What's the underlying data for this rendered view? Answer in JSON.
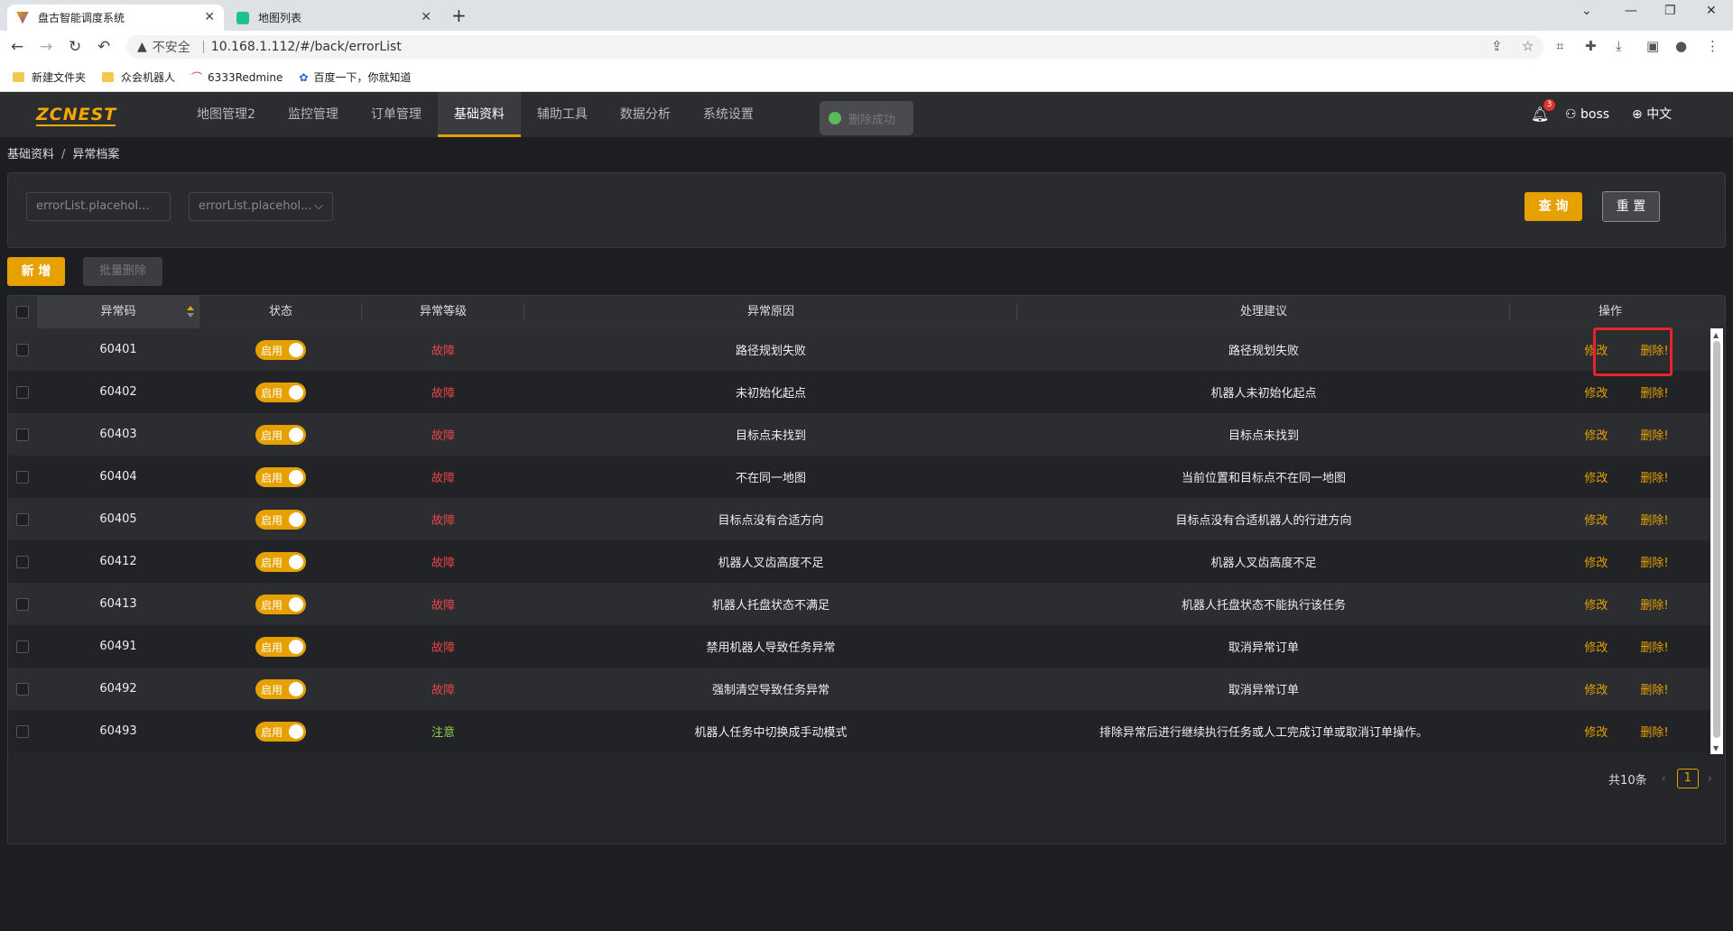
{
  "browser": {
    "tabs": [
      {
        "title": "盘古智能调度系统",
        "active": true
      },
      {
        "title": "地图列表",
        "active": false
      }
    ],
    "address": {
      "security": "不安全",
      "url": "10.168.1.112/#/back/errorList"
    },
    "bookmarks": [
      "新建文件夹",
      "众会机器人",
      "6333Redmine",
      "百度一下，你就知道"
    ]
  },
  "app": {
    "logo": "ZCNEST",
    "menu": [
      "地图管理2",
      "监控管理",
      "订单管理",
      "基础资料",
      "辅助工具",
      "数据分析",
      "系统设置"
    ],
    "active_menu": "基础资料",
    "toast": "删除成功",
    "notification_count": "3",
    "user": "boss",
    "language": "中文"
  },
  "breadcrumb": {
    "parent": "基础资料",
    "current": "异常档案"
  },
  "search": {
    "code_placeholder": "errorList.placehol...",
    "level_placeholder": "errorList.placehol...",
    "query_label": "查 询",
    "reset_label": "重 置"
  },
  "toolbar": {
    "add_label": "新 增",
    "batch_delete_label": "批量删除"
  },
  "table": {
    "columns": [
      "异常码",
      "状态",
      "异常等级",
      "异常原因",
      "处理建议",
      "操作"
    ],
    "status_label": "启用",
    "edit_label": "修改",
    "delete_label": "删除!",
    "rows": [
      {
        "code": "60401",
        "level": "故障",
        "level_type": "fault",
        "reason": "路径规划失败",
        "suggestion": "路径规划失败"
      },
      {
        "code": "60402",
        "level": "故障",
        "level_type": "fault",
        "reason": "未初始化起点",
        "suggestion": "机器人未初始化起点"
      },
      {
        "code": "60403",
        "level": "故障",
        "level_type": "fault",
        "reason": "目标点未找到",
        "suggestion": "目标点未找到"
      },
      {
        "code": "60404",
        "level": "故障",
        "level_type": "fault",
        "reason": "不在同一地图",
        "suggestion": "当前位置和目标点不在同一地图"
      },
      {
        "code": "60405",
        "level": "故障",
        "level_type": "fault",
        "reason": "目标点没有合适方向",
        "suggestion": "目标点没有合适机器人的行进方向"
      },
      {
        "code": "60412",
        "level": "故障",
        "level_type": "fault",
        "reason": "机器人叉齿高度不足",
        "suggestion": "机器人叉齿高度不足"
      },
      {
        "code": "60413",
        "level": "故障",
        "level_type": "fault",
        "reason": "机器人托盘状态不满足",
        "suggestion": "机器人托盘状态不能执行该任务"
      },
      {
        "code": "60491",
        "level": "故障",
        "level_type": "fault",
        "reason": "禁用机器人导致任务异常",
        "suggestion": "取消异常订单"
      },
      {
        "code": "60492",
        "level": "故障",
        "level_type": "fault",
        "reason": "强制清空导致任务异常",
        "suggestion": "取消异常订单"
      },
      {
        "code": "60493",
        "level": "注意",
        "level_type": "warn",
        "reason": "机器人任务中切换成手动模式",
        "suggestion": "排除异常后进行继续执行任务或人工完成订单或取消订单操作。"
      }
    ]
  },
  "pagination": {
    "total": "共10条",
    "current_page": "1"
  },
  "colors": {
    "accent": "#e6a100",
    "fault": "#e84545",
    "warn": "#8fd14f",
    "highlight": "#e8232a"
  }
}
